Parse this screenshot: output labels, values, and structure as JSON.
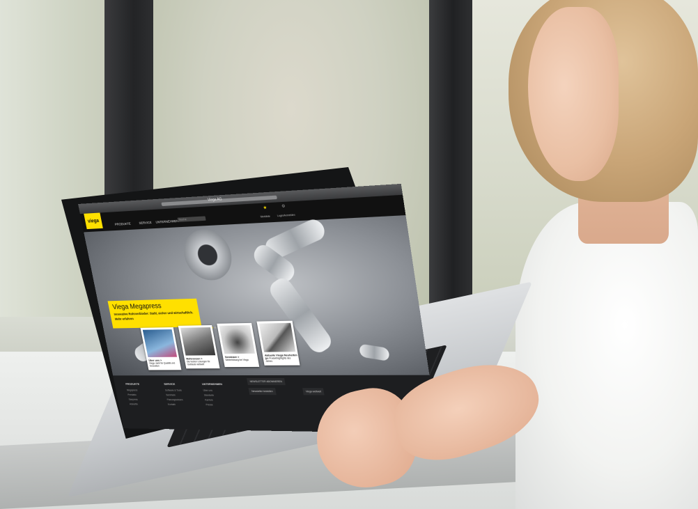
{
  "browser": {
    "title": "Viega AG"
  },
  "site": {
    "logo": "viega",
    "nav": [
      "PRODUKTE",
      "SERVICE",
      "UNTERNEHMEN"
    ],
    "search_placeholder": "Suche",
    "icons": [
      {
        "icon": "star-icon",
        "label": "Merkliste"
      },
      {
        "icon": "user-icon",
        "label": "Login/Anmelden"
      }
    ]
  },
  "hero": {
    "title": "Viega Megapress",
    "subtitle": "Innovative Rohrverbinder: Stahl, sicher und wirtschaftlich.",
    "link": "Mehr erfahren",
    "slides": 8,
    "active_slide": 1
  },
  "cards": [
    {
      "title": "Über uns >",
      "text": "Viega: steht für Qualität und Innovation"
    },
    {
      "title": "Referenzen >",
      "text": "Die besten Lösungen für Gebäude weltweit"
    },
    {
      "title": "Seminare >",
      "text": "Weiterbildung bei Viega"
    },
    {
      "title": "Aktuelle Viega Neuheiten >",
      "text": "Die Produkthighlights des Jahres"
    }
  ],
  "footer": {
    "columns": [
      {
        "head": "PRODUKTE",
        "items": [
          "Megapress",
          "Prestabo",
          "Sanpress",
          "Advantix"
        ]
      },
      {
        "head": "SERVICE",
        "items": [
          "Software & Tools",
          "Seminare",
          "Planungswissen",
          "Kontakt"
        ]
      },
      {
        "head": "UNTERNEHMEN",
        "items": [
          "Über uns",
          "Standorte",
          "Karriere",
          "Presse"
        ]
      }
    ],
    "buttons": [
      "NEWSLETTER ABONNIEREN",
      "Newsletter bestellen",
      "Viega weltweit"
    ]
  }
}
